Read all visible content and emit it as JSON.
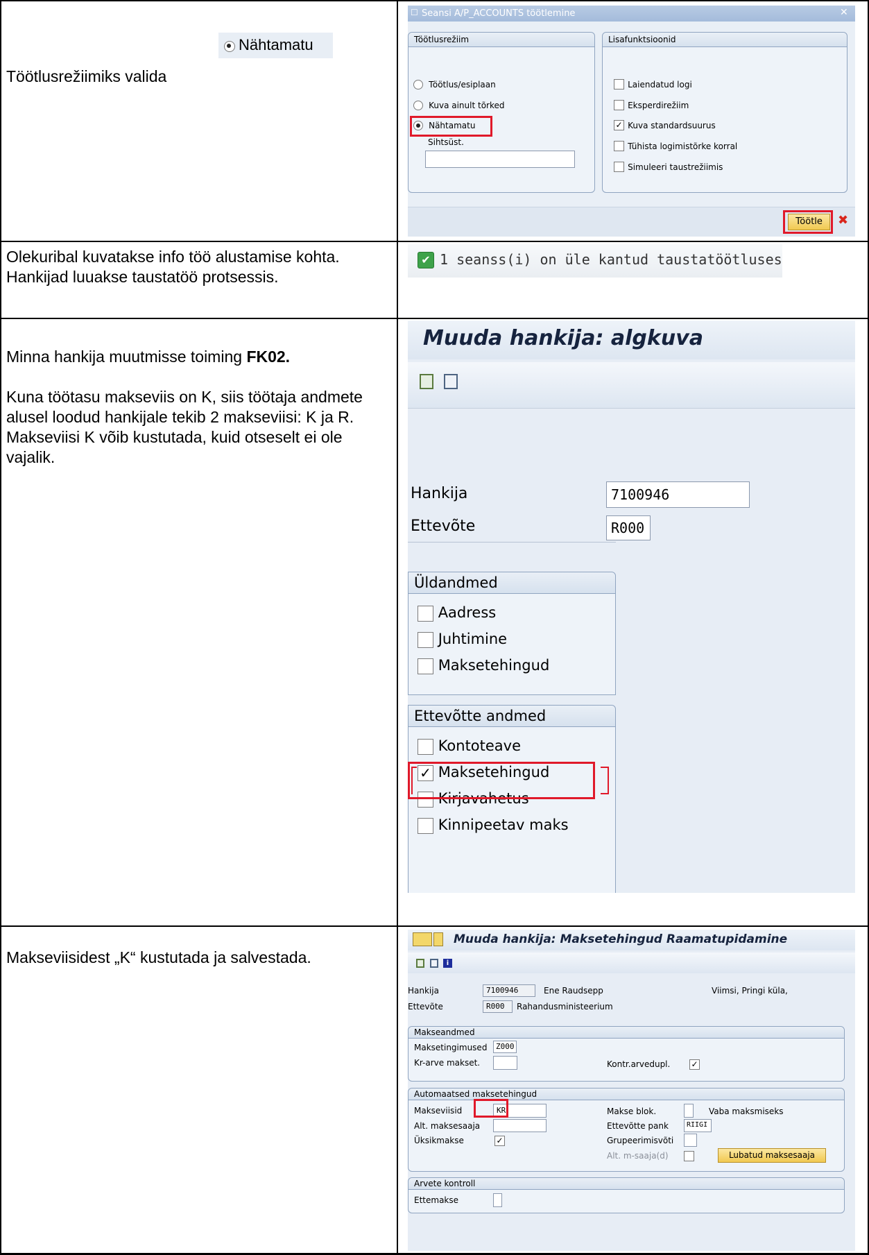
{
  "rows": [
    {
      "instruction": "Töötlusrežiimiks valida"
    },
    {
      "instruction": "Olekuribal kuvatakse info töö alustamise kohta. Hankijad luuakse taustatöö protsessis."
    },
    {
      "instruction_prefix": "Minna hankija muutmisse toiming ",
      "instruction_code": "FK02.",
      "instruction_more": "Kuna töötasu makseviis on K, siis töötaja andmete alusel loodud hankijale tekib 2 makseviisi: K ja R. Makseviisi K võib kustutada, kuid otseselt ei ole vajalik."
    },
    {
      "instruction": "Makseviisidest „K“ kustutada ja salvestada."
    }
  ],
  "snippet_radio_label": "Nähtamatu",
  "dialog": {
    "title": "Seansi A/P_ACCOUNTS töötlemine",
    "group_mode": "Töötlusrežiim",
    "group_extra": "Lisafunktsioonid",
    "radios": [
      "Töötlus/esiplaan",
      "Kuva ainult tõrked",
      "Nähtamatu"
    ],
    "radio_selected": 2,
    "target_label": "Sihtsüst.",
    "target_value": "",
    "checks": [
      "Laiendatud logi",
      "Eksperdirežiim",
      "Kuva standardsuurus",
      "Tühista logimistõrke korral",
      "Simuleeri taustrežiimis"
    ],
    "checks_state": [
      false,
      false,
      true,
      false,
      false
    ],
    "process_button": "Töötle",
    "close_glyph": "✕",
    "cancel_glyph": "✖"
  },
  "status": {
    "message": "1 seanss(i) on üle kantud taustatöötlusesse.",
    "ok_glyph": "✔"
  },
  "initial_screen": {
    "title": "Muuda hankija: algkuva",
    "vendor_label": "Hankija",
    "vendor_value": "7100946",
    "company_label": "Ettevõte",
    "company_value": "R000",
    "general_title": "Üldandmed",
    "general_items": [
      "Aadress",
      "Juhtimine",
      "Maksetehingud"
    ],
    "company_title": "Ettevõtte andmed",
    "company_items": [
      "Kontoteave",
      "Maksetehingud",
      "Kirjavahetus",
      "Kinnipeetav maks"
    ],
    "company_checked": [
      false,
      true,
      false,
      false
    ],
    "check_glyph": "✓"
  },
  "payment_screen": {
    "title": "Muuda hankija: Maksetehingud Raamatupidamine",
    "vendor_label": "Hankija",
    "vendor_value": "7100946",
    "vendor_name": "Ene Raudsepp",
    "vendor_city": "Viimsi, Pringi küla,",
    "company_label": "Ettevõte",
    "company_value": "R000",
    "company_name": "Rahandusministeerium",
    "grp1_title": "Makseandmed",
    "terms_label": "Maksetingimused",
    "terms_value": "Z000",
    "credit_label": "Kr-arve makset.",
    "credit_value": "",
    "dup_label": "Kontr.arvedupl.",
    "dup_checked": true,
    "grp2_title": "Automaatsed maksetehingud",
    "methods_label": "Makseviisid",
    "methods_value": "KR",
    "alt_payee_label": "Alt. maksesaaja",
    "alt_payee_value": "",
    "single_label": "Üksikmakse",
    "single_checked": true,
    "block_label": "Makse blok.",
    "block_value": "",
    "block_text": "Vaba maksmiseks",
    "house_bank_label": "Ettevõtte pank",
    "house_bank_value": "RIIGI",
    "group_key_label": "Grupeerimisvõti",
    "group_key_value": "",
    "alt_docs_label": "Alt. m-saaja(d)",
    "permitted_button": "Lubatud maksesaaja",
    "grp3_title": "Arvete kontroll",
    "prepay_label": "Ettemakse",
    "prepay_value": ""
  }
}
